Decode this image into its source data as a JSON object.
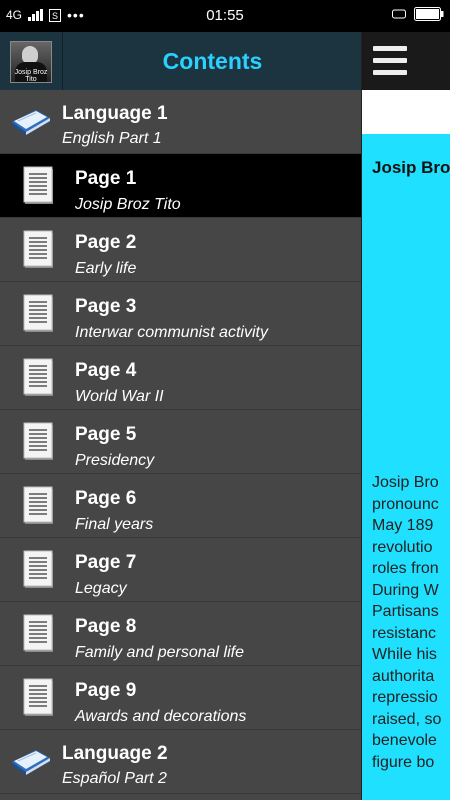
{
  "status_bar": {
    "network": "4G",
    "time": "01:55"
  },
  "drawer": {
    "title": "Contents",
    "items": [
      {
        "type": "language",
        "title": "Language 1",
        "subtitle": "English Part 1"
      },
      {
        "type": "page",
        "title": "Page 1",
        "subtitle": "Josip Broz Tito",
        "selected": true
      },
      {
        "type": "page",
        "title": "Page 2",
        "subtitle": "Early life"
      },
      {
        "type": "page",
        "title": "Page 3",
        "subtitle": "Interwar communist activity"
      },
      {
        "type": "page",
        "title": "Page 4",
        "subtitle": "World War II"
      },
      {
        "type": "page",
        "title": "Page 5",
        "subtitle": "Presidency"
      },
      {
        "type": "page",
        "title": "Page 6",
        "subtitle": "Final years"
      },
      {
        "type": "page",
        "title": "Page 7",
        "subtitle": "Legacy"
      },
      {
        "type": "page",
        "title": "Page 8",
        "subtitle": "Family and personal life"
      },
      {
        "type": "page",
        "title": "Page 9",
        "subtitle": "Awards and decorations"
      },
      {
        "type": "language",
        "title": "Language 2",
        "subtitle": "Español Part 2"
      }
    ]
  },
  "content": {
    "heading": "Josip Bro",
    "body_lines": [
      "Josip Bro",
      "pronounc",
      "May 189",
      "revolutio",
      "roles fron",
      "During W",
      "Partisans",
      "resistanc",
      "While his",
      "authorita",
      "repressio",
      "raised, so",
      "benevole",
      "figure bo"
    ]
  },
  "colors": {
    "header_bg": "#1b3440",
    "title_accent": "#2ad0ff",
    "content_bg": "#1fe0ff",
    "drawer_bg": "#464646",
    "selected_bg": "#000000"
  }
}
